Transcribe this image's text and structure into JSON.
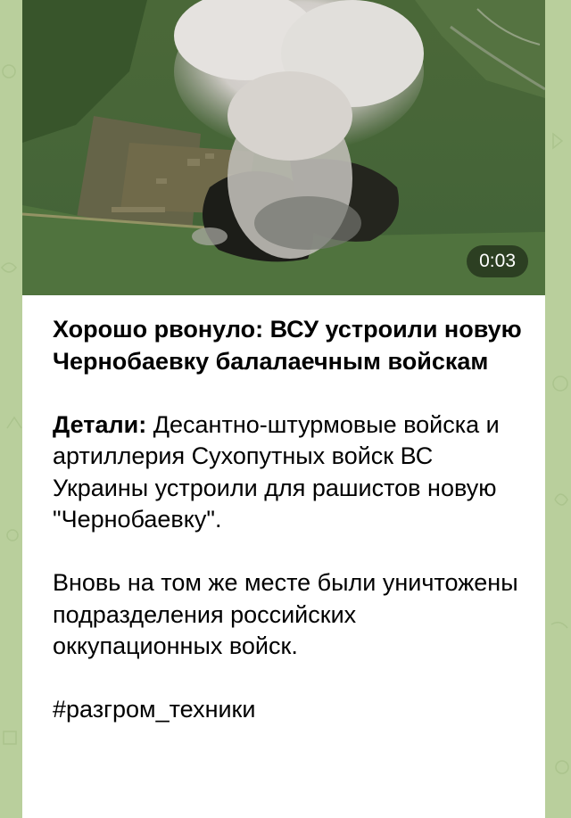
{
  "video": {
    "duration": "0:03"
  },
  "post": {
    "title": "Хорошо рвонуло: ВСУ устроили новую Чернобаевку балалаечным войскам",
    "details_label": "Детали:",
    "details_text": " Десантно-штурмовые войска и артиллерия Сухопутных войск ВС Украины устроили для рашистов новую \"Чернобаевку\".",
    "paragraph2": "Вновь на том же месте были уничтожены подразделения российских оккупационных войск.",
    "hashtag": "#разгром_техники"
  },
  "colors": {
    "chat_background": "#b9cf9c",
    "bubble": "#ffffff",
    "text": "#000000",
    "duration_badge": "rgba(0,0,0,0.45)"
  }
}
